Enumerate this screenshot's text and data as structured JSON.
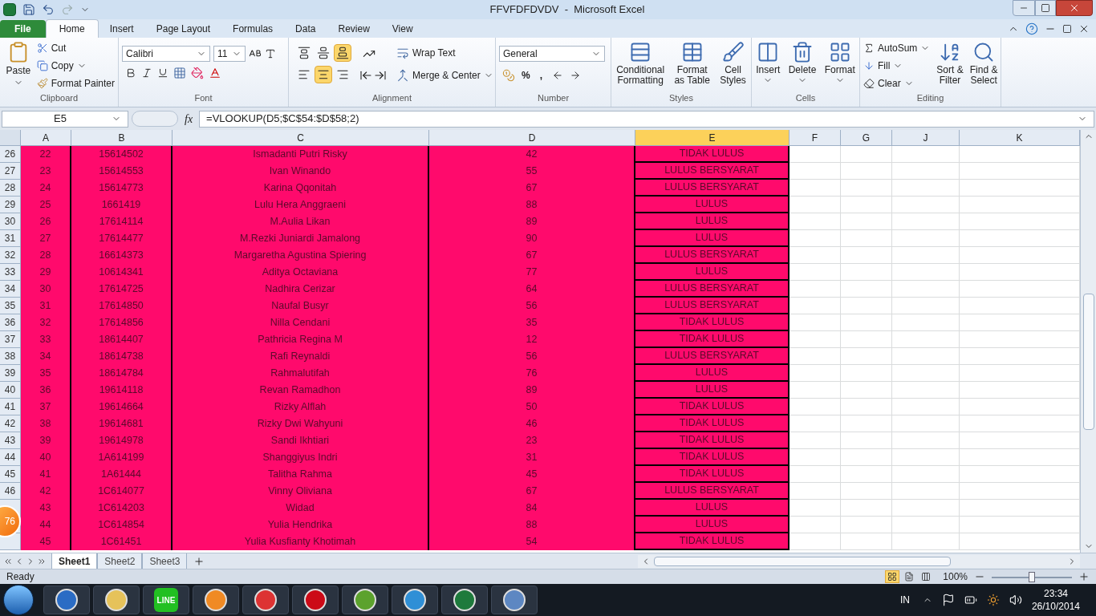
{
  "title_bar": {
    "title": "FFVFDFDVDV  -  Microsoft Excel"
  },
  "tabs": [
    {
      "label": "File",
      "kind": "file",
      "selected": false
    },
    {
      "label": "Home",
      "kind": "tab",
      "selected": true
    },
    {
      "label": "Insert",
      "kind": "tab",
      "selected": false
    },
    {
      "label": "Page Layout",
      "kind": "tab",
      "selected": false
    },
    {
      "label": "Formulas",
      "kind": "tab",
      "selected": false
    },
    {
      "label": "Data",
      "kind": "tab",
      "selected": false
    },
    {
      "label": "Review",
      "kind": "tab",
      "selected": false
    },
    {
      "label": "View",
      "kind": "tab",
      "selected": false
    }
  ],
  "ribbon": {
    "clipboard": {
      "label": "Clipboard",
      "paste": "Paste",
      "cut": "Cut",
      "copy": "Copy",
      "format_painter": "Format Painter"
    },
    "font": {
      "label": "Font",
      "font_name": "Calibri",
      "font_size": "11"
    },
    "alignment": {
      "label": "Alignment",
      "wrap_text": "Wrap Text",
      "merge": "Merge & Center",
      "vertical": [
        {
          "selected": false
        },
        {
          "selected": false
        },
        {
          "selected": true
        }
      ],
      "horizontal": [
        {
          "selected": false
        },
        {
          "selected": true
        },
        {
          "selected": false
        }
      ]
    },
    "number": {
      "label": "Number",
      "format": "General",
      "percent": "%",
      "comma": ","
    },
    "styles": {
      "label": "Styles",
      "buttons": [
        [
          "Conditional",
          "Formatting"
        ],
        [
          "Format",
          "as Table"
        ],
        [
          "Cell",
          "Styles"
        ]
      ]
    },
    "cells": {
      "label": "Cells",
      "buttons": [
        "Insert",
        "Delete",
        "Format"
      ]
    },
    "editing": {
      "label": "Editing",
      "autosum": "AutoSum",
      "fill": "Fill",
      "clear": "Clear",
      "buttons": [
        [
          "Sort &",
          "Filter"
        ],
        [
          "Find &",
          "Select"
        ]
      ]
    }
  },
  "formula_bar": {
    "name_box": "E5",
    "fx": "fx",
    "formula": "=VLOOKUP(D5;$C$54:$D$58;2)"
  },
  "columns": [
    {
      "label": "A",
      "selected": false
    },
    {
      "label": "B",
      "selected": false
    },
    {
      "label": "C",
      "selected": false
    },
    {
      "label": "D",
      "selected": false
    },
    {
      "label": "E",
      "selected": true
    },
    {
      "label": "F",
      "selected": false
    },
    {
      "label": "G",
      "selected": false
    },
    {
      "label": "J",
      "selected": false
    },
    {
      "label": "K",
      "selected": false
    }
  ],
  "rows": [
    {
      "row": "26",
      "a": "22",
      "b": "15614502",
      "c": "Ismadanti Putri Risky",
      "d": "42",
      "e": "TIDAK LULUS"
    },
    {
      "row": "27",
      "a": "23",
      "b": "15614553",
      "c": "Ivan Winando",
      "d": "55",
      "e": "LULUS BERSYARAT"
    },
    {
      "row": "28",
      "a": "24",
      "b": "15614773",
      "c": "Karina Qqonitah",
      "d": "67",
      "e": "LULUS BERSYARAT"
    },
    {
      "row": "29",
      "a": "25",
      "b": "1661419",
      "c": "Lulu Hera Anggraeni",
      "d": "88",
      "e": "LULUS"
    },
    {
      "row": "30",
      "a": "26",
      "b": "17614114",
      "c": "M.Aulia Likan",
      "d": "89",
      "e": "LULUS"
    },
    {
      "row": "31",
      "a": "27",
      "b": "17614477",
      "c": "M.Rezki Juniardi Jamalong",
      "d": "90",
      "e": "LULUS"
    },
    {
      "row": "32",
      "a": "28",
      "b": "16614373",
      "c": "Margaretha Agustina Spiering",
      "d": "67",
      "e": "LULUS BERSYARAT"
    },
    {
      "row": "33",
      "a": "29",
      "b": "10614341",
      "c": "Aditya Octaviana",
      "d": "77",
      "e": "LULUS"
    },
    {
      "row": "34",
      "a": "30",
      "b": "17614725",
      "c": "Nadhira Cerizar",
      "d": "64",
      "e": "LULUS BERSYARAT"
    },
    {
      "row": "35",
      "a": "31",
      "b": "17614850",
      "c": "Naufal Busyr",
      "d": "56",
      "e": "LULUS BERSYARAT"
    },
    {
      "row": "36",
      "a": "32",
      "b": "17614856",
      "c": "Nilla Cendani",
      "d": "35",
      "e": "TIDAK LULUS"
    },
    {
      "row": "37",
      "a": "33",
      "b": "18614407",
      "c": "Pathricia Regina M",
      "d": "12",
      "e": "TIDAK LULUS"
    },
    {
      "row": "38",
      "a": "34",
      "b": "18614738",
      "c": "Rafi Reynaldi",
      "d": "56",
      "e": "LULUS BERSYARAT"
    },
    {
      "row": "39",
      "a": "35",
      "b": "18614784",
      "c": "Rahmalutifah",
      "d": "76",
      "e": "LULUS"
    },
    {
      "row": "40",
      "a": "36",
      "b": "19614118",
      "c": "Revan Ramadhon",
      "d": "89",
      "e": "LULUS"
    },
    {
      "row": "41",
      "a": "37",
      "b": "19614664",
      "c": "Rizky Alflah",
      "d": "50",
      "e": "TIDAK LULUS"
    },
    {
      "row": "42",
      "a": "38",
      "b": "19614681",
      "c": "Rizky Dwi Wahyuni",
      "d": "46",
      "e": "TIDAK LULUS"
    },
    {
      "row": "43",
      "a": "39",
      "b": "19614978",
      "c": "Sandi Ikhtiari",
      "d": "23",
      "e": "TIDAK LULUS"
    },
    {
      "row": "44",
      "a": "40",
      "b": "1A614199",
      "c": "Shanggiyus Indri",
      "d": "31",
      "e": "TIDAK LULUS"
    },
    {
      "row": "45",
      "a": "41",
      "b": "1A61444",
      "c": "Talitha Rahma",
      "d": "45",
      "e": "TIDAK LULUS"
    },
    {
      "row": "46",
      "a": "42",
      "b": "1C614077",
      "c": "Vinny Oliviana",
      "d": "67",
      "e": "LULUS BERSYARAT"
    },
    {
      "a": "43",
      "b": "1C614203",
      "c": "Widad",
      "d": "84",
      "e": "LULUS"
    },
    {
      "a": "44",
      "b": "1C614854",
      "c": "Yulia Hendrika",
      "d": "88",
      "e": "LULUS"
    },
    {
      "a": "45",
      "b": "1C61451",
      "c": "Yulia Kusfianty Khotimah",
      "d": "54",
      "e": "TIDAK LULUS"
    }
  ],
  "overlay_badge": "76",
  "sheet_tabs": [
    {
      "label": "Sheet1",
      "selected": true
    },
    {
      "label": "Sheet2",
      "selected": false
    },
    {
      "label": "Sheet3",
      "selected": false
    }
  ],
  "status_bar": {
    "status": "Ready",
    "zoom": "100%",
    "zoom_slider": {
      "level": 0.5
    },
    "views": [
      {
        "selected": true
      },
      {
        "selected": false
      },
      {
        "selected": false
      }
    ]
  },
  "taskbar": {
    "line_label": "LINE",
    "language": "IN",
    "time": "23:34",
    "date": "26/10/2014"
  }
}
